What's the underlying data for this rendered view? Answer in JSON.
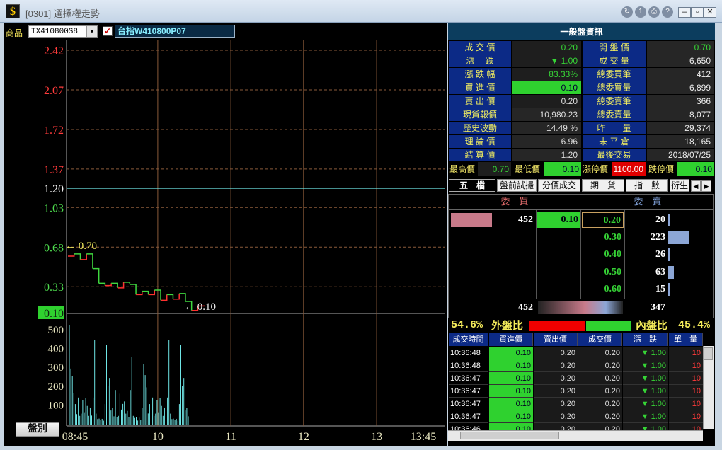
{
  "window": {
    "title": "[0301] 選擇權走勢",
    "icon": "$",
    "toolbar_icons": [
      "refresh-icon",
      "info-icon",
      "print-icon",
      "help-icon"
    ]
  },
  "toolbar": {
    "product_label": "商品",
    "product_code": "TX410800S8",
    "product_name": "台指W410800P07"
  },
  "chart_data": {
    "type": "line",
    "price_axis_ticks": [
      "2.42",
      "2.07",
      "1.72",
      "1.37",
      "1.20",
      "1.03",
      "0.68",
      "0.33",
      "0.10"
    ],
    "reference_price": 1.2,
    "high_annotation": "← 0.70",
    "low_annotation": "← 0.10",
    "x_tick_labels": [
      "08:45",
      "10",
      "11",
      "12",
      "13",
      "13:45"
    ],
    "volume_axis_ticks": [
      "500",
      "400",
      "300",
      "200",
      "100"
    ],
    "price_series": [
      {
        "t": "08:45",
        "v": 0.6
      },
      {
        "t": "08:50",
        "v": 0.62
      },
      {
        "t": "08:55",
        "v": 0.57
      },
      {
        "t": "09:00",
        "v": 0.62
      },
      {
        "t": "09:05",
        "v": 0.49
      },
      {
        "t": "09:10",
        "v": 0.36
      },
      {
        "t": "09:15",
        "v": 0.34
      },
      {
        "t": "09:20",
        "v": 0.36
      },
      {
        "t": "09:25",
        "v": 0.32
      },
      {
        "t": "09:30",
        "v": 0.37
      },
      {
        "t": "09:35",
        "v": 0.35
      },
      {
        "t": "09:40",
        "v": 0.26
      },
      {
        "t": "09:45",
        "v": 0.29
      },
      {
        "t": "09:50",
        "v": 0.26
      },
      {
        "t": "09:55",
        "v": 0.3
      },
      {
        "t": "10:00",
        "v": 0.21
      },
      {
        "t": "10:05",
        "v": 0.26
      },
      {
        "t": "10:10",
        "v": 0.22
      },
      {
        "t": "10:15",
        "v": 0.27
      },
      {
        "t": "10:20",
        "v": 0.2
      },
      {
        "t": "10:25",
        "v": 0.12
      },
      {
        "t": "10:30",
        "v": 0.16
      },
      {
        "t": "10:36",
        "v": 0.16
      }
    ],
    "volume_series": [
      520,
      290,
      250,
      80,
      110,
      60,
      200,
      40,
      60,
      170,
      90,
      150,
      120,
      60,
      90,
      50,
      200,
      460,
      60,
      30,
      40,
      20,
      30,
      20,
      110
    ]
  },
  "display_button": "盤別",
  "info": {
    "header": "一般盤資訊",
    "left": [
      {
        "label": "成 交 價",
        "value": "0.20"
      },
      {
        "label": "漲　 跌",
        "value": "▼ 1.00"
      },
      {
        "label": "漲 跌 幅",
        "value": "83.33%"
      },
      {
        "label": "買 進 價",
        "value": "0.10"
      },
      {
        "label": "賣 出 價",
        "value": "0.20"
      },
      {
        "label": "現貨報價",
        "value": "10,980.23"
      },
      {
        "label": "歷史波動",
        "value": "14.49 %"
      },
      {
        "label": "理 論 價",
        "value": "6.96"
      },
      {
        "label": "結 算 價",
        "value": "1.20"
      }
    ],
    "right": [
      {
        "label": "開 盤 價",
        "value": "0.70"
      },
      {
        "label": "成 交 量",
        "value": "6,650"
      },
      {
        "label": "總委買筆",
        "value": "412"
      },
      {
        "label": "總委買量",
        "value": "6,899"
      },
      {
        "label": "總委賣筆",
        "value": "366"
      },
      {
        "label": "總委賣量",
        "value": "8,077"
      },
      {
        "label": "昨　　量",
        "value": "29,374"
      },
      {
        "label": "未 平 倉",
        "value": "18,165"
      },
      {
        "label": "最後交易",
        "value": "2018/07/25"
      }
    ],
    "limits": [
      {
        "label": "最高價",
        "value": "0.70"
      },
      {
        "label": "最低價",
        "value": "0.10"
      },
      {
        "label": "漲停價",
        "value": "1100.00"
      },
      {
        "label": "跌停價",
        "value": "0.10"
      }
    ]
  },
  "tabs": [
    "五　檔",
    "盤前試撮",
    "分價成交",
    "期　貨",
    "指　數",
    "衍生"
  ],
  "orderbook": {
    "bid_header": "委　買",
    "ask_header": "委　賣",
    "bid_qty": "452",
    "bid_price": "0.10",
    "asks": [
      {
        "price": "0.20",
        "qty": "20"
      },
      {
        "price": "0.30",
        "qty": "223"
      },
      {
        "price": "0.40",
        "qty": "26"
      },
      {
        "price": "0.50",
        "qty": "63"
      },
      {
        "price": "0.60",
        "qty": "15"
      }
    ],
    "bid_total": "452",
    "ask_total": "347",
    "outer_pct": "54.6%",
    "outer_label": "外盤比",
    "inner_label": "內盤比",
    "inner_pct": "45.4%"
  },
  "trades": {
    "headers": [
      "成交時間",
      "買進價",
      "賣出價",
      "成交價",
      "漲　跌",
      "單　量"
    ],
    "rows": [
      {
        "time": "10:36:48",
        "bid": "0.10",
        "ask": "0.20",
        "price": "0.20",
        "chg": "▼ 1.00",
        "qty": "10"
      },
      {
        "time": "10:36:48",
        "bid": "0.10",
        "ask": "0.20",
        "price": "0.20",
        "chg": "▼ 1.00",
        "qty": "10"
      },
      {
        "time": "10:36:47",
        "bid": "0.10",
        "ask": "0.20",
        "price": "0.20",
        "chg": "▼ 1.00",
        "qty": "10"
      },
      {
        "time": "10:36:47",
        "bid": "0.10",
        "ask": "0.20",
        "price": "0.20",
        "chg": "▼ 1.00",
        "qty": "10"
      },
      {
        "time": "10:36:47",
        "bid": "0.10",
        "ask": "0.20",
        "price": "0.20",
        "chg": "▼ 1.00",
        "qty": "10"
      },
      {
        "time": "10:36:47",
        "bid": "0.10",
        "ask": "0.20",
        "price": "0.20",
        "chg": "▼ 1.00",
        "qty": "10"
      },
      {
        "time": "10:36:46",
        "bid": "0.10",
        "ask": "0.20",
        "price": "0.20",
        "chg": "▼ 1.00",
        "qty": "10"
      }
    ]
  }
}
